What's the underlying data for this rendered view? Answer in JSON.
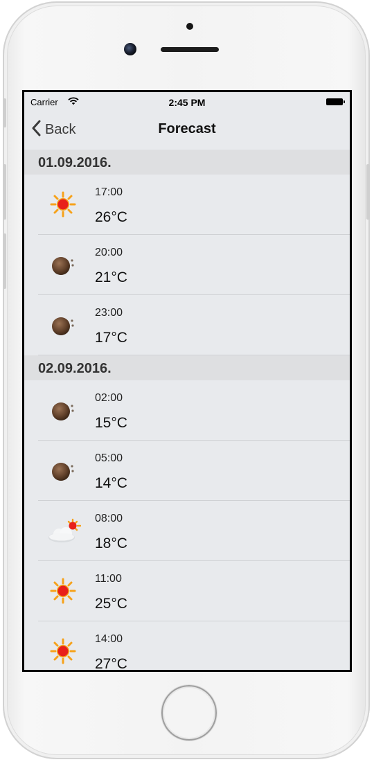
{
  "status_bar": {
    "carrier": "Carrier",
    "time": "2:45 PM"
  },
  "nav": {
    "back_label": "Back",
    "title": "Forecast"
  },
  "sections": [
    {
      "date": "01.09.2016.",
      "rows": [
        {
          "time": "17:00",
          "temp": "26°C",
          "icon": "sun-icon"
        },
        {
          "time": "20:00",
          "temp": "21°C",
          "icon": "night-icon"
        },
        {
          "time": "23:00",
          "temp": "17°C",
          "icon": "night-icon"
        }
      ]
    },
    {
      "date": "02.09.2016.",
      "rows": [
        {
          "time": "02:00",
          "temp": "15°C",
          "icon": "night-icon"
        },
        {
          "time": "05:00",
          "temp": "14°C",
          "icon": "night-icon"
        },
        {
          "time": "08:00",
          "temp": "18°C",
          "icon": "cloud-sun-icon"
        },
        {
          "time": "11:00",
          "temp": "25°C",
          "icon": "sun-icon"
        },
        {
          "time": "14:00",
          "temp": "27°C",
          "icon": "sun-icon"
        }
      ]
    }
  ],
  "colors": {
    "screen_bg": "#e8eaed",
    "section_bg": "#dedfe1",
    "sun": "#e8201a",
    "sun_rays": "#f6a21a",
    "moon": "#6b4a32"
  }
}
